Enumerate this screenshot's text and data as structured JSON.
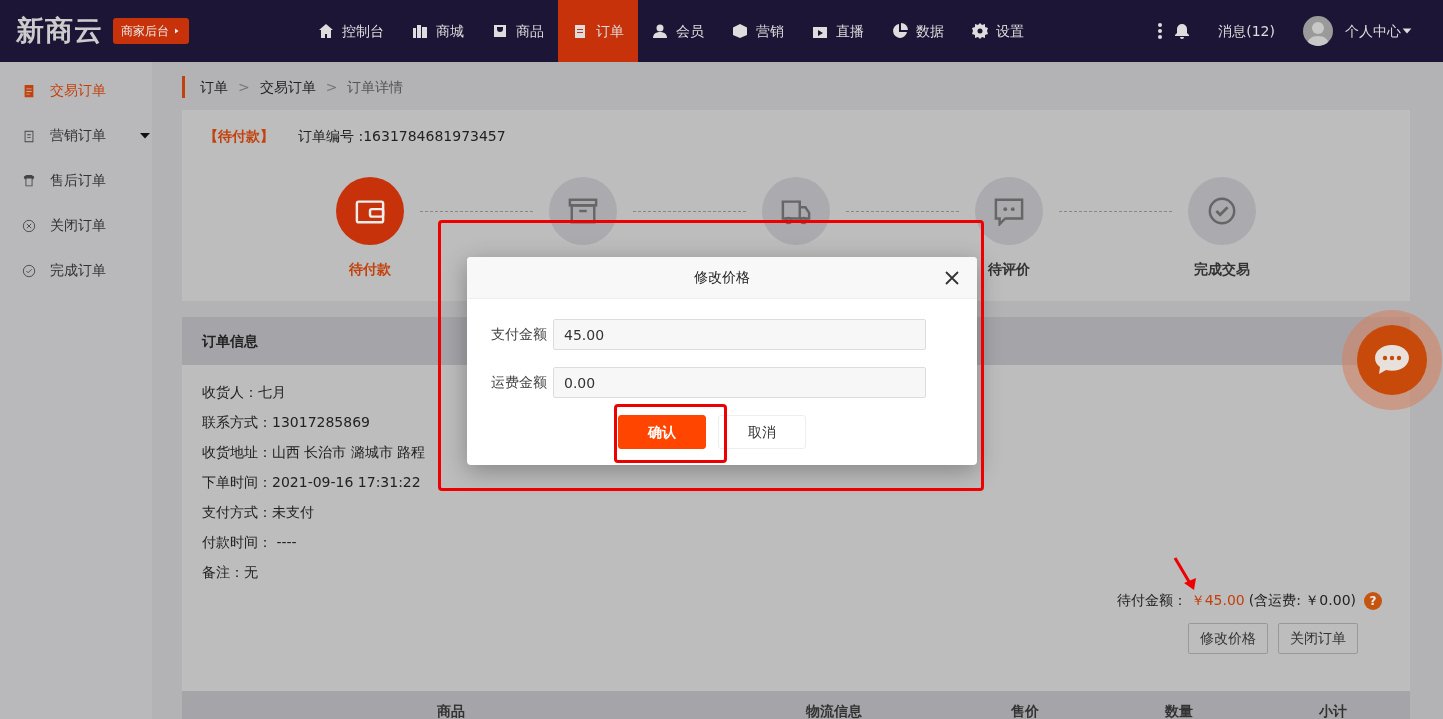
{
  "brand": {
    "logo": "新商云",
    "switch_button": "商家后台"
  },
  "nav": {
    "items": [
      {
        "label": "控制台",
        "selected": false
      },
      {
        "label": "商城",
        "selected": false
      },
      {
        "label": "商品",
        "selected": false
      },
      {
        "label": "订单",
        "selected": true
      },
      {
        "label": "会员",
        "selected": false
      },
      {
        "label": "营销",
        "selected": false
      },
      {
        "label": "直播",
        "selected": false
      },
      {
        "label": "数据",
        "selected": false
      },
      {
        "label": "设置",
        "selected": false
      }
    ],
    "messages": "消息(12)",
    "user": "个人中心"
  },
  "sidebar": {
    "items": [
      {
        "label": "交易订单",
        "selected": true,
        "has_submenu": false
      },
      {
        "label": "营销订单",
        "selected": false,
        "has_submenu": true
      },
      {
        "label": "售后订单",
        "selected": false,
        "has_submenu": false
      },
      {
        "label": "关闭订单",
        "selected": false,
        "has_submenu": false
      },
      {
        "label": "完成订单",
        "selected": false,
        "has_submenu": false
      }
    ]
  },
  "breadcrumb": {
    "separator": ">",
    "items": [
      "订单",
      "交易订单",
      "订单详情"
    ]
  },
  "order": {
    "status": "【待付款】",
    "number": "订单编号 :1631784681973457"
  },
  "steps": [
    {
      "label": "待付款",
      "selected": true
    },
    {
      "selected": false
    },
    {
      "selected": false
    },
    {
      "label": "待评价",
      "selected": false
    },
    {
      "label": "完成交易",
      "selected": false
    }
  ],
  "order_info": {
    "title": "订单信息",
    "lines": [
      "收货人：七月",
      "联系方式：13017285869",
      "收货地址：山西 长治市 潞城市 路程",
      "下单时间：2021-09-16 17:31:22",
      "支付方式：未支付",
      "付款时间： ----",
      "备注：无"
    ]
  },
  "totals": {
    "label": "待付金额：",
    "amount": "￥45.00",
    "shipping": "(含运费: ￥0.00)",
    "help": "?"
  },
  "actions": [
    "修改价格",
    "关闭订单"
  ],
  "table": {
    "columns": [
      "商品",
      "物流信息",
      "售价",
      "数量",
      "小计"
    ]
  },
  "modal": {
    "title": "修改价格",
    "fields": [
      {
        "label": "支付金额",
        "value": "45.00"
      },
      {
        "label": "运费金额",
        "value": "0.00"
      }
    ],
    "buttons": [
      {
        "label": "确认",
        "kind": "primary"
      },
      {
        "label": "取消",
        "kind": "secondary"
      }
    ]
  },
  "annotations": [
    {
      "kind": "box"
    },
    {
      "kind": "box"
    },
    {
      "kind": "arrow"
    }
  ]
}
